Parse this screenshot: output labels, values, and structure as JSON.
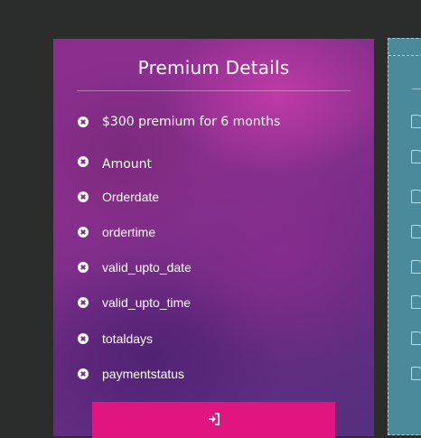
{
  "card": {
    "title": "Premium Details",
    "rows": [
      {
        "label": "$300 premium for 6 months"
      },
      {
        "label": "Amount"
      },
      {
        "label": "Orderdate"
      },
      {
        "label": "ordertime"
      },
      {
        "label": "valid_upto_date"
      },
      {
        "label": "valid_upto_time"
      },
      {
        "label": "totaldays"
      },
      {
        "label": "paymentstatus"
      }
    ],
    "submit_icon": "sign-in-icon"
  },
  "colors": {
    "background": "#2b2c2c",
    "card_gradient_top": "#8b2f8f",
    "card_gradient_bottom": "#54307e",
    "button": "#e0157f",
    "side_panel": "#4a8a9a"
  }
}
